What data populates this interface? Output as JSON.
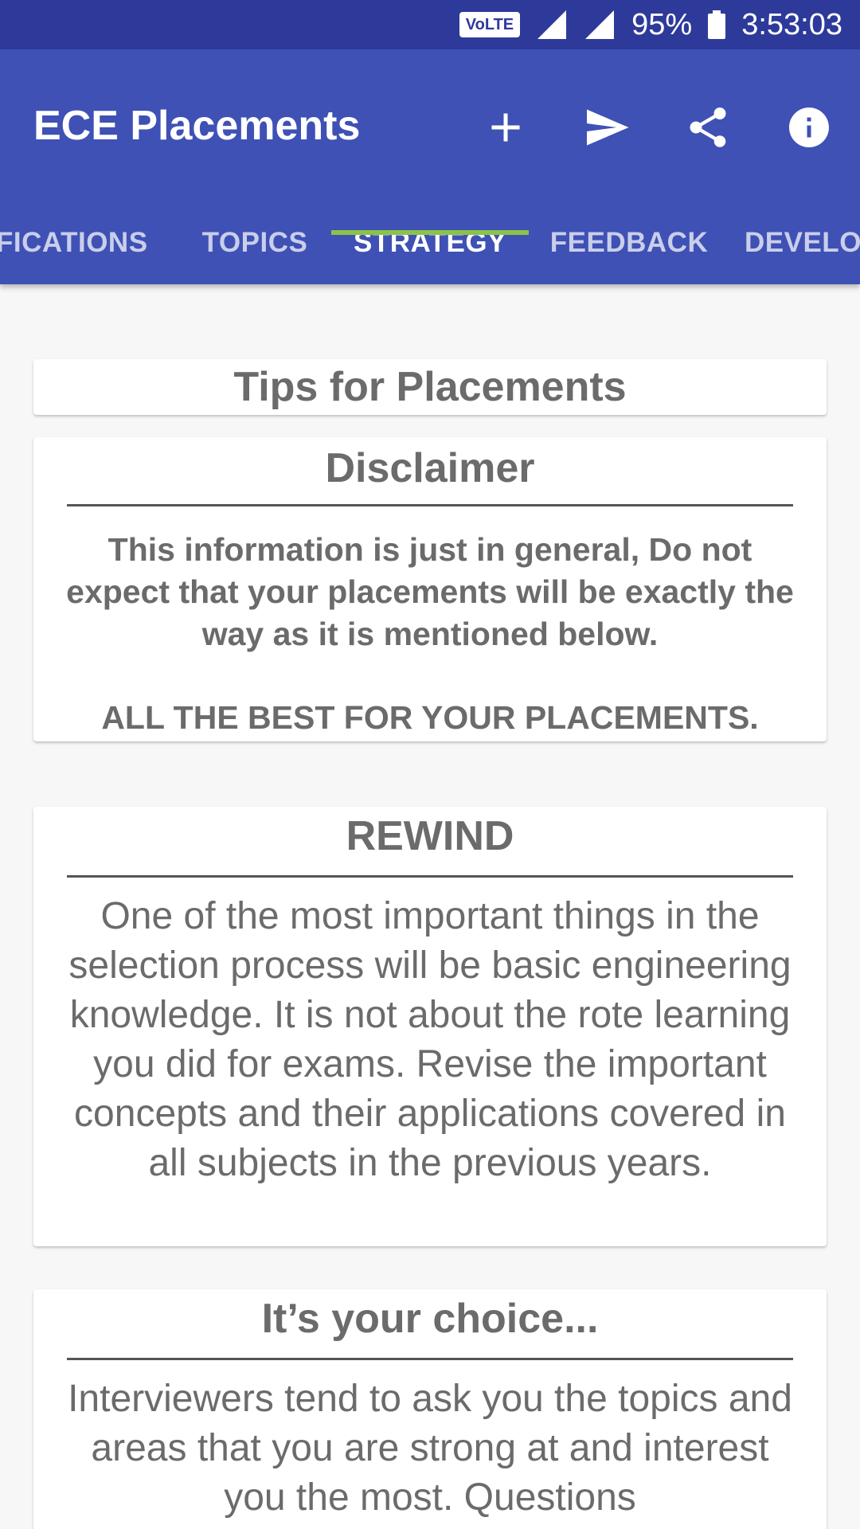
{
  "status_bar": {
    "volte": "VoLTE",
    "battery": "95%",
    "time": "3:53:03"
  },
  "app": {
    "title": "ECE Placements",
    "colors": {
      "primary": "#3f51b5",
      "status_bar": "#2e3a99",
      "tab_indicator": "#8bc34a"
    },
    "actions": [
      {
        "name": "add-icon"
      },
      {
        "name": "send-icon"
      },
      {
        "name": "share-icon"
      },
      {
        "name": "info-icon"
      }
    ]
  },
  "tabs": [
    {
      "label": "NOTIFICATIONS",
      "active": false
    },
    {
      "label": "TOPICS",
      "active": false
    },
    {
      "label": "STRATEGY",
      "active": true
    },
    {
      "label": "FEEDBACK",
      "active": false
    },
    {
      "label": "DEVELOPERS",
      "active": false
    }
  ],
  "cards": {
    "tips": {
      "title": "Tips for Placements"
    },
    "disclaimer": {
      "title": "Disclaimer",
      "body": "This information is just in general, Do not expect that your placements will be exactly the way as it is mentioned below.",
      "footer": "ALL THE BEST FOR YOUR PLACEMENTS."
    },
    "rewind": {
      "title": "REWIND",
      "body": "One of the most important things in the selection process will be basic engineering knowledge. It is not about the rote learning you did for exams. Revise the important concepts and their applications covered in all subjects in the previous years."
    },
    "choice": {
      "title": "It’s your choice...",
      "body": "Interviewers tend to ask you the topics and areas that you are strong at and interest you the most. Questions"
    }
  }
}
